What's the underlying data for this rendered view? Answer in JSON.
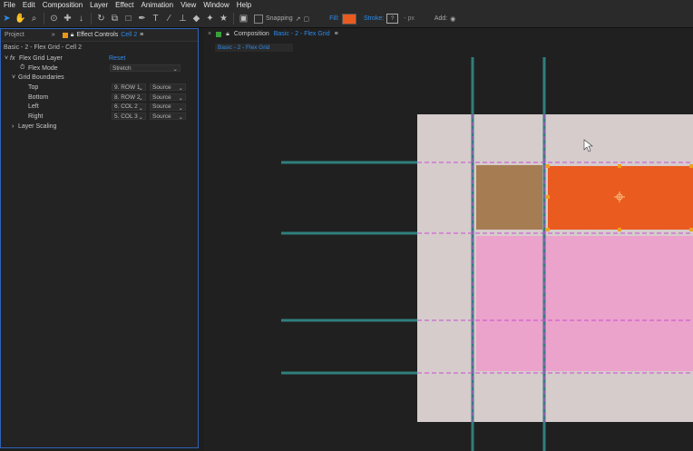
{
  "menu": [
    "File",
    "Edit",
    "Composition",
    "Layer",
    "Effect",
    "Animation",
    "View",
    "Window",
    "Help"
  ],
  "toolbar": {
    "snapping_label": "Snapping",
    "fill_label": "Fill:",
    "stroke_label": "Stroke:",
    "stroke_value": "?",
    "stroke_unit": "- px",
    "add_label": "Add:",
    "fill_color": "#ea5b20"
  },
  "left_panel": {
    "tab_project": "Project",
    "tab_effect_controls": "Effect Controls",
    "tab_cell": "Cell 2",
    "breadcrumb": "Basic - 2 - Flex Grid - Cell 2",
    "effect_name": "Flex Grid Layer",
    "fx_label": "fx",
    "reset_label": "Reset",
    "flex_mode_label": "Flex Mode",
    "flex_mode_value": "Stretch",
    "grid_boundaries_label": "Grid Boundaries",
    "boundaries": [
      {
        "label": "Top",
        "value": "9. ROW 1",
        "source": "Source"
      },
      {
        "label": "Bottom",
        "value": "8. ROW 2",
        "source": "Source"
      },
      {
        "label": "Left",
        "value": "6. COL 2",
        "source": "Source"
      },
      {
        "label": "Right",
        "value": "5. COL 3",
        "source": "Source"
      }
    ],
    "layer_scaling_label": "Layer Scaling"
  },
  "comp_panel": {
    "tab_prefix": "Composition",
    "tab_name": "Basic - 2 - Flex Grid",
    "subtab": "Basic - 2 - Flex Grid"
  },
  "colors": {
    "bg_cell": "#d6cccb",
    "brown_cell": "#a67c52",
    "orange_cell": "#ea5b20",
    "pink_cell": "#eca3cb",
    "guide_teal": "#2f7f7c",
    "guide_magenta": "#c94bd6",
    "handle": "#f0a020"
  }
}
